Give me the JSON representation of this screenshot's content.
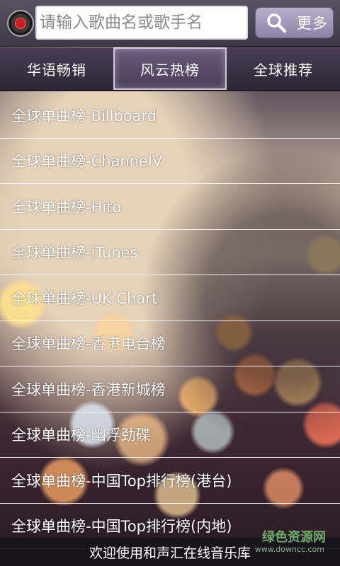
{
  "search": {
    "placeholder": "请输入歌曲名或歌手名",
    "button_label": "更多"
  },
  "tabs": [
    {
      "label": "华语畅销",
      "active": false
    },
    {
      "label": "风云热榜",
      "active": true
    },
    {
      "label": "全球推荐",
      "active": false
    }
  ],
  "list": [
    {
      "label": "全球单曲榜-Billboard"
    },
    {
      "label": "全球单曲榜-ChannelV"
    },
    {
      "label": "全球单曲榜-Hito"
    },
    {
      "label": "全球单曲榜-iTunes"
    },
    {
      "label": "全球单曲榜-UK Chart"
    },
    {
      "label": "全球单曲榜-香港电台榜"
    },
    {
      "label": "全球单曲榜-香港新城榜"
    },
    {
      "label": "全球单曲榜-幽浮劲碟"
    },
    {
      "label": "全球单曲榜-中国Top排行榜(港台)"
    },
    {
      "label": "全球单曲榜-中国Top排行榜(内地)"
    }
  ],
  "footer": {
    "text": "欢迎使用和声汇在线音乐库"
  },
  "watermark": {
    "text": "绿色资源网",
    "url": "www.downcc.com"
  },
  "colors": {
    "accent": "#8e82a8",
    "record": "#d01c1c"
  }
}
